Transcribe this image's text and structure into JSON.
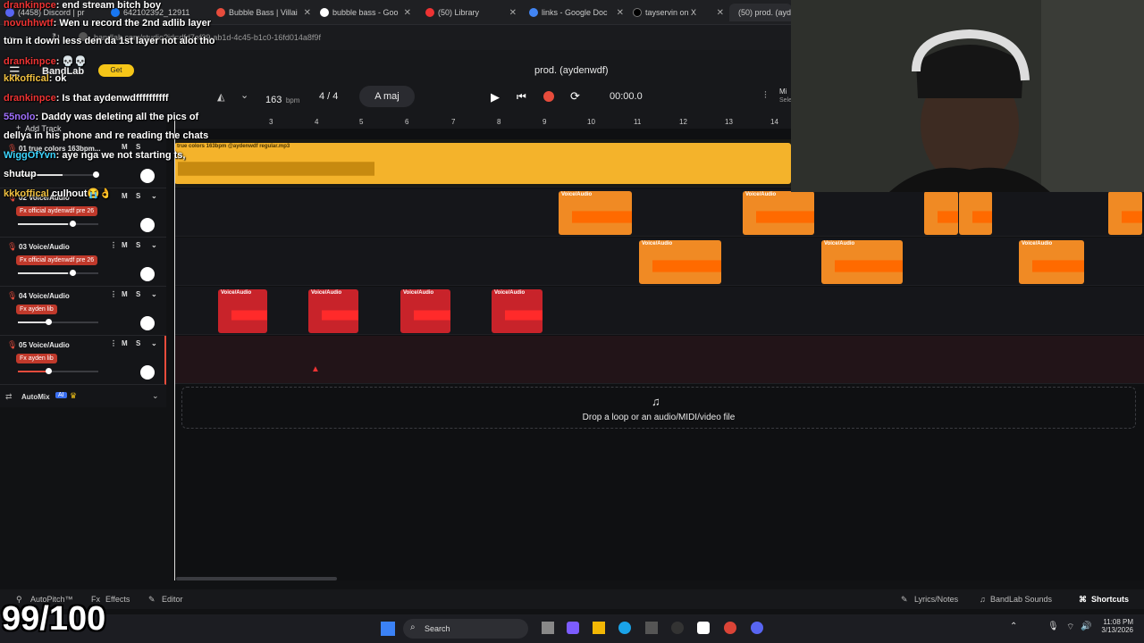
{
  "browser": {
    "tabs": [
      {
        "label": "(4458) Discord | pr"
      },
      {
        "label": "642102392_12911"
      },
      {
        "label": "Bubble Bass | Villai"
      },
      {
        "label": "bubble bass - Goo"
      },
      {
        "label": "(50) Library"
      },
      {
        "label": "links - Google Doc"
      },
      {
        "label": "tayservin on X"
      },
      {
        "label": "(50) prod. (ayd"
      }
    ],
    "url": "bandlab.com/studio?id=dfd7ef39-ab1d-4c45-b1c0-16fd014a8f9f"
  },
  "app": {
    "project_title": "prod. (aydenwdf)",
    "tempo": "163",
    "tempo_unit": "bpm",
    "time_signature": "4 / 4",
    "key": "A maj",
    "time": "00:00.0",
    "add_track_label": "Add Track",
    "mixer_label": "Mi",
    "mixer_sub": "Sele",
    "get_label": "Get"
  },
  "ruler": [
    "3",
    "4",
    "5",
    "6",
    "7",
    "8",
    "9",
    "10",
    "11",
    "12",
    "13",
    "14"
  ],
  "tracks": [
    {
      "name": "01  true colors 163bpm...",
      "fx": "",
      "volume": 0.55,
      "clips": [
        {
          "label": "true colors 163bpm @aydenwdf regular.mp3"
        }
      ]
    },
    {
      "name": "02  Voice/Audio",
      "fx": "Fx  official aydenwdf pre 26",
      "volume": 0.62,
      "clips": [
        {
          "label": "Voice/Audio"
        },
        {
          "label": "Voice/Audio"
        },
        {
          "label": ""
        },
        {
          "label": ""
        }
      ]
    },
    {
      "name": "03  Voice/Audio",
      "fx": "Fx  official aydenwdf pre 26",
      "volume": 0.62,
      "clips": [
        {
          "label": "Voice/Audio"
        },
        {
          "label": "Voice/Audio"
        },
        {
          "label": "Voice/Audio"
        }
      ]
    },
    {
      "name": "04  Voice/Audio",
      "fx": "Fx  ayden lib",
      "volume": 0.37,
      "clips": [
        {
          "label": "Voice/Audio"
        },
        {
          "label": "Voice/Audio"
        },
        {
          "label": "Voice/Audio"
        },
        {
          "label": "Voice/Audio"
        }
      ]
    },
    {
      "name": "05  Voice/Audio",
      "fx": "Fx  ayden lib",
      "volume": 0.37,
      "clips": []
    }
  ],
  "automix": {
    "label": "AutoMix",
    "badge": "AI"
  },
  "drop_zone": {
    "text": "Drop a loop or an audio/MIDI/video file"
  },
  "bottom_bar": {
    "autopitch": "AutoPitch™",
    "effects": "Effects",
    "editor": "Editor",
    "lyrics": "Lyrics/Notes",
    "sounds": "BandLab Sounds",
    "shortcuts": "Shortcuts"
  },
  "taskbar": {
    "search": "Search",
    "time": "11:08 PM",
    "date": "3/13/2026"
  },
  "chat": [
    {
      "user": "drankinpce",
      "msg": "end stream bitch boy"
    },
    {
      "user": "novuhhwtf",
      "msg": "Wen u record the 2nd adlib layer"
    },
    {
      "user": "",
      "msg": "turn it down less den da 1st layer not alot tho"
    },
    {
      "user": "drankinpce",
      "msg": "💀💀"
    },
    {
      "user": "kkkoffical",
      "msg": "ok"
    },
    {
      "user": "drankinpce",
      "msg": "Is that aydenwdffffffffff"
    },
    {
      "user": "55nolo",
      "msg": "Daddy  was deleting all the pics of"
    },
    {
      "user": "",
      "msg": "dellya in his phone and re reading the chats"
    },
    {
      "user": "WiggOfYvn",
      "msg": "aye nga we not starting ts,"
    },
    {
      "user": "",
      "msg": "shutup"
    },
    {
      "user": "kkkoffical",
      "msg": "culhout😭👌"
    }
  ],
  "overlay_score": "99/100",
  "colors": {
    "orange_clip": "#f08a24",
    "red_clip": "#c8232a",
    "gold_master": "#f4b32b",
    "rec": "#e74c3c"
  }
}
